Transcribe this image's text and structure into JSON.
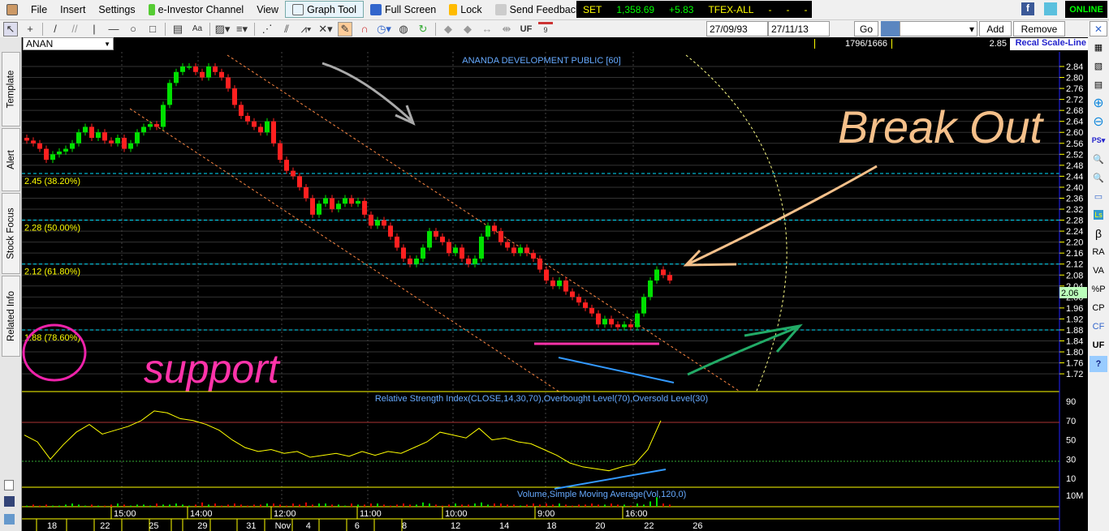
{
  "menu": {
    "items": [
      "File",
      "Insert",
      "Settings",
      "e-Investor Channel",
      "View",
      "Graph Tool",
      "Full Screen",
      "Lock",
      "Send Feedback"
    ]
  },
  "ticker": {
    "index": "SET",
    "value": "1,358.69",
    "change": "+5.83",
    "market": "TFEX-ALL",
    "d1": "-",
    "d2": "-",
    "d3": "-"
  },
  "status": "ONLINE",
  "toolbar": {
    "uf_label": "UF",
    "calendar_day": "9",
    "date_from": "27/09/93",
    "date_to": "27/11/13",
    "go_label": "Go",
    "add_label": "Add",
    "remove_label": "Remove"
  },
  "symbol": {
    "value": "ANAN"
  },
  "info": {
    "counter": "1796/1666",
    "price": "2.85",
    "recal_label": "Recal Scale-Line"
  },
  "left_tabs": [
    "Template",
    "Alert",
    "Stock Focus",
    "Related Info"
  ],
  "right_tools": [
    "β",
    "RA",
    "VA",
    "%P",
    "CP",
    "CF",
    "UF",
    "?"
  ],
  "chart_data": {
    "type": "candlestick",
    "title": "ANANDA DEVELOPMENT PUBLIC [60]",
    "ylim": [
      1.7,
      2.86
    ],
    "y_ticks": [
      "2.84",
      "2.80",
      "2.76",
      "2.72",
      "2.68",
      "2.64",
      "2.60",
      "2.56",
      "2.52",
      "2.48",
      "2.44",
      "2.40",
      "2.36",
      "2.32",
      "2.28",
      "2.24",
      "2.20",
      "2.16",
      "2.12",
      "2.08",
      "2.04",
      "2.00",
      "1.96",
      "1.92",
      "1.88",
      "1.84",
      "1.80",
      "1.76",
      "1.72"
    ],
    "last_price": "2.06",
    "fib_levels": [
      {
        "value": 2.45,
        "label": "2.45 (38.20%)"
      },
      {
        "value": 2.28,
        "label": "2.28 (50.00%)"
      },
      {
        "value": 2.12,
        "label": "2.12 (61.80%)"
      },
      {
        "value": 1.88,
        "label": "1.88 (78.60%)"
      }
    ],
    "close": [
      2.57,
      2.56,
      2.54,
      2.5,
      2.52,
      2.53,
      2.54,
      2.56,
      2.6,
      2.62,
      2.58,
      2.6,
      2.57,
      2.56,
      2.58,
      2.54,
      2.56,
      2.6,
      2.62,
      2.63,
      2.62,
      2.7,
      2.78,
      2.82,
      2.84,
      2.84,
      2.82,
      2.8,
      2.84,
      2.82,
      2.8,
      2.76,
      2.7,
      2.66,
      2.64,
      2.62,
      2.6,
      2.64,
      2.56,
      2.5,
      2.46,
      2.44,
      2.4,
      2.36,
      2.3,
      2.34,
      2.36,
      2.32,
      2.34,
      2.36,
      2.34,
      2.35,
      2.3,
      2.26,
      2.28,
      2.26,
      2.22,
      2.18,
      2.14,
      2.12,
      2.14,
      2.18,
      2.24,
      2.22,
      2.2,
      2.16,
      2.18,
      2.14,
      2.12,
      2.14,
      2.22,
      2.26,
      2.24,
      2.2,
      2.18,
      2.16,
      2.18,
      2.16,
      2.14,
      2.1,
      2.06,
      2.04,
      2.06,
      2.02,
      2.0,
      1.98,
      1.96,
      1.94,
      1.9,
      1.92,
      1.9,
      1.89,
      1.9,
      1.89,
      1.94,
      2.0,
      2.06,
      2.1,
      2.08,
      2.06
    ],
    "rsi": {
      "title": "Relative Strength Index(CLOSE,14,30,70),Overbought Level(70),Oversold Level(30)",
      "overbought": 70,
      "oversold": 30,
      "ticks": [
        "90",
        "70",
        "50",
        "30",
        "10"
      ],
      "values": [
        55,
        48,
        30,
        45,
        58,
        66,
        56,
        60,
        64,
        70,
        80,
        78,
        72,
        70,
        66,
        60,
        50,
        42,
        38,
        40,
        36,
        38,
        32,
        34,
        36,
        33,
        38,
        34,
        38,
        36,
        42,
        48,
        58,
        55,
        52,
        62,
        50,
        52,
        48,
        46,
        40,
        34,
        26,
        22,
        20,
        18,
        22,
        25,
        40,
        70
      ]
    },
    "volume": {
      "title": "Volume,Simple Moving Average(Vol,120,0)",
      "tick": "10M",
      "values": [
        1,
        2,
        1,
        2,
        1,
        1,
        2,
        3,
        2,
        1,
        2,
        1,
        1,
        2,
        3,
        2,
        1,
        2,
        2,
        1,
        3,
        2,
        2,
        3,
        2,
        1,
        2,
        4,
        2,
        3,
        1,
        2,
        3,
        2,
        1,
        2,
        2,
        3,
        3,
        2,
        1,
        3,
        2,
        4,
        2,
        3,
        3,
        2,
        2,
        1,
        3,
        2,
        2,
        3,
        3,
        2,
        1,
        2,
        3,
        2,
        2,
        4,
        3,
        2,
        1,
        2,
        3,
        2,
        2,
        3,
        4,
        2,
        3,
        3,
        2,
        2,
        1,
        2,
        3,
        2,
        3,
        2,
        3,
        2,
        1,
        2,
        2,
        3,
        2,
        2,
        3,
        2,
        2,
        1,
        3,
        2,
        5,
        9,
        3,
        2
      ]
    },
    "time_labels": [
      "15:00",
      "14:00",
      "12:00",
      "11:00",
      "10:00",
      "9:00",
      "16:00"
    ],
    "date_labels": [
      "18",
      "22",
      "25",
      "29",
      "31",
      "Nov",
      "4",
      "6",
      "8",
      "12",
      "14",
      "18",
      "20",
      "22",
      "26"
    ]
  },
  "annotations": {
    "breakout": "Break Out",
    "support": "support"
  },
  "colors": {
    "up": "#00e000",
    "down": "#ff2020",
    "fib": "#00e0ff",
    "axis": "#ffff00"
  }
}
